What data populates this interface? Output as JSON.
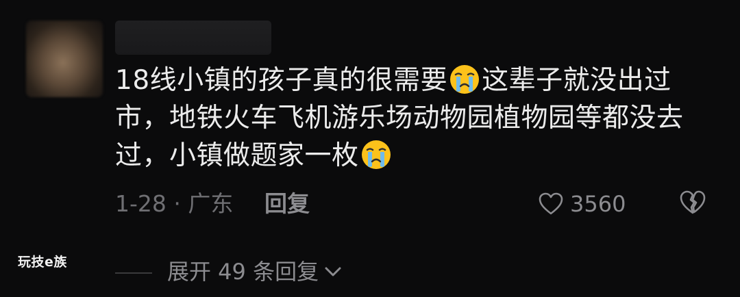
{
  "comment": {
    "text_part1": "18线小镇的孩子真的很需要",
    "emoji_1": "crying-face-emoji",
    "text_part2": "这辈子就没出过市，地铁火车飞机游乐场动物园植物园等都没去过，小镇做题家一枚",
    "emoji_2": "crying-face-emoji",
    "date_location": "1-28 · 广东",
    "reply_label": "回复",
    "like_count": "3560",
    "expand_label": "展开 49 条回复"
  },
  "watermark": "玩技e族",
  "colors": {
    "background": "#0b0b0c",
    "primary_text": "#ececec",
    "secondary_text": "#8c8c90",
    "meta_text": "#6f6f73"
  }
}
